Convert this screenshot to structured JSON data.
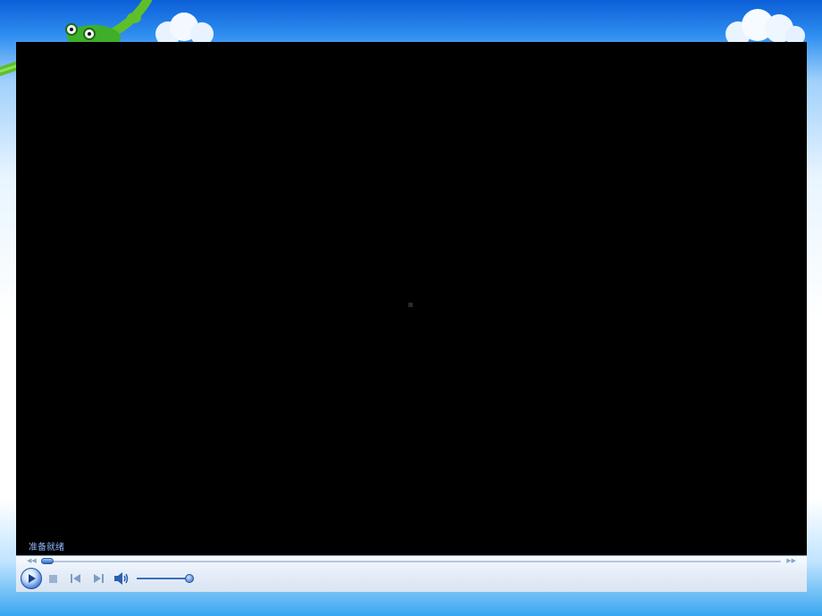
{
  "player": {
    "status_text": "准备就绪",
    "seek_position": 0.0,
    "volume_level": 0.9
  },
  "icons": {
    "play": "play-icon",
    "stop": "stop-icon",
    "previous": "previous-icon",
    "next": "next-icon",
    "volume": "volume-icon",
    "seek_back": "rewind-icon",
    "seek_forward": "fast-forward-icon"
  },
  "colors": {
    "video_background": "#000000",
    "status_text": "#8fb7ff",
    "accent": "#2f6fcf",
    "sky_top": "#0b5fd8"
  }
}
